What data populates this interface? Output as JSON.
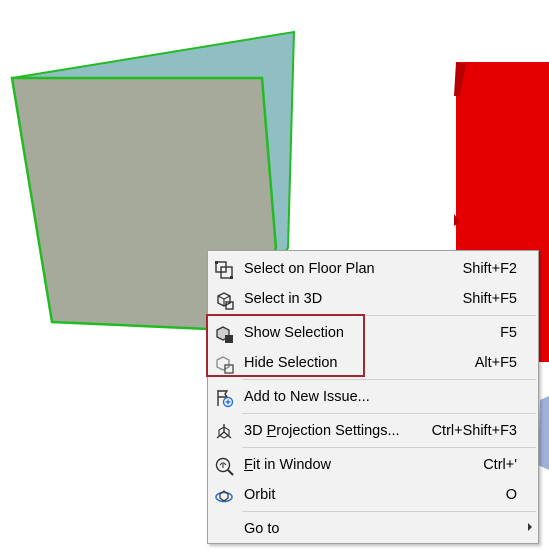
{
  "scene": {
    "gray_panel_color": "#a6aa9b",
    "teal_panel_color": "#8fbfc3",
    "edge_highlight_color": "#22bb22",
    "red_object_color": "#e50000"
  },
  "context_menu": {
    "items": [
      {
        "label": "Select on Floor Plan",
        "shortcut": "Shift+F2",
        "icon": "floor-plan-select-icon"
      },
      {
        "label": "Select in 3D",
        "shortcut": "Shift+F5",
        "icon": "select-3d-icon"
      },
      {
        "label": "Show Selection",
        "shortcut": "F5",
        "icon": "show-selection-icon"
      },
      {
        "label": "Hide Selection",
        "shortcut": "Alt+F5",
        "icon": "hide-selection-icon"
      },
      {
        "label": "Add to New Issue...",
        "shortcut": "",
        "icon": "add-issue-icon"
      },
      {
        "label_ul": "P",
        "label_pre": "3D ",
        "label_post": "rojection Settings...",
        "shortcut": "Ctrl+Shift+F3",
        "icon": "projection-settings-icon"
      },
      {
        "label_ul": "F",
        "label_pre": "",
        "label_post": "it in Window",
        "shortcut": "Ctrl+'",
        "icon": "fit-in-window-icon"
      },
      {
        "label": "Orbit",
        "shortcut": "O",
        "icon": "orbit-icon"
      },
      {
        "label": "Go to",
        "shortcut": "",
        "icon": ""
      }
    ],
    "highlight_color": "#a0282e"
  }
}
